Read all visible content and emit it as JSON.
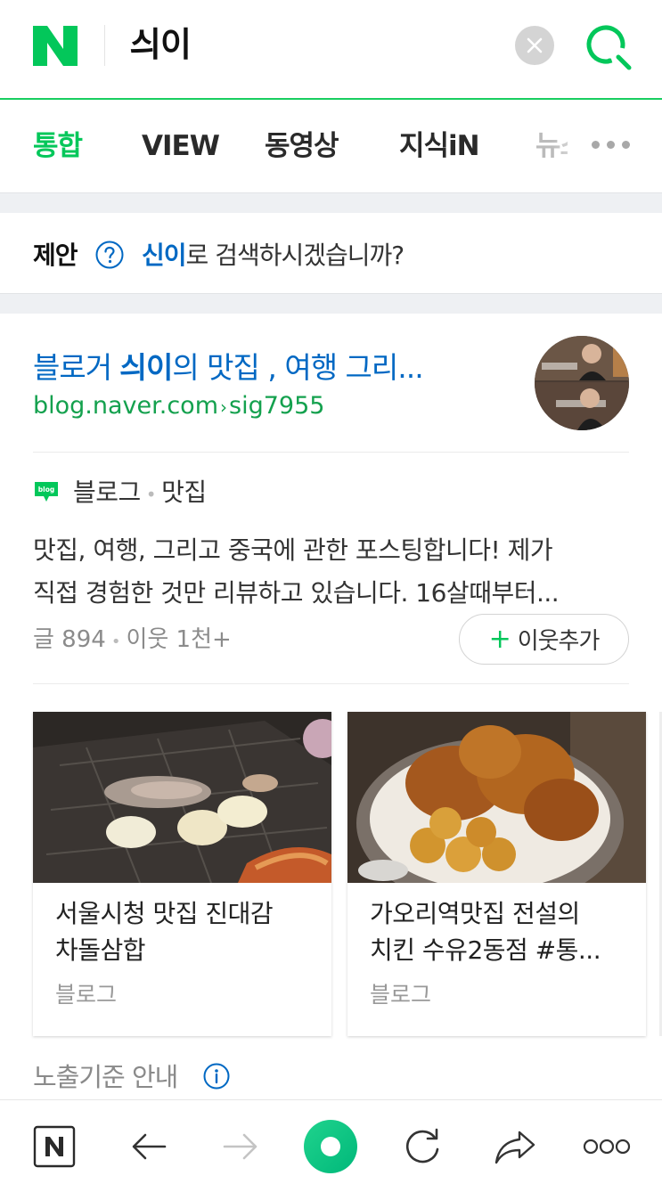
{
  "header": {
    "logo_alt": "N",
    "query": "싀이",
    "brand_color": "#03c75a"
  },
  "tabs": [
    {
      "label": "통합",
      "active": true
    },
    {
      "label": "VIEW",
      "active": false
    },
    {
      "label": "동영상",
      "active": false
    },
    {
      "label": "지식iN",
      "active": false
    },
    {
      "label": "뉴스",
      "active": false
    }
  ],
  "suggestion": {
    "label": "제안",
    "keyword": "신이",
    "rest": "로 검색하시겠습니까?"
  },
  "blog": {
    "title_prefix": "블로거 ",
    "title_keyword": "싀이",
    "title_suffix": "의 맛집 , 여행 그리...",
    "url_domain": "blog.naver.com",
    "url_path": "sig7955",
    "badge_text": "blog",
    "category_type": "블로그",
    "category_topic": "맛집",
    "description_lines": [
      "맛집, 여행, 그리고 중국에 관한 포스팅합니다! 제가",
      "직접 경험한 것만 리뷰하고 있습니다. 16살때부터..."
    ],
    "posts": "글 894",
    "neighbors": "이웃 1천+",
    "add_neighbor_label": "이웃추가",
    "thumbnails": [
      {
        "title_lines": [
          "서울시청 맛집 진대감",
          "차돌삼합"
        ],
        "source": "블로그"
      },
      {
        "title_lines": [
          "가오리역맛집 전설의",
          "치킨 수유2동점 #통..."
        ],
        "source": "블로그"
      }
    ]
  },
  "notice": {
    "label": "노출기준 안내"
  },
  "bottom_bar": {
    "items": [
      "naver-home-icon",
      "back-icon",
      "forward-icon",
      "green-dot-icon",
      "refresh-icon",
      "share-icon",
      "more-icon"
    ]
  }
}
